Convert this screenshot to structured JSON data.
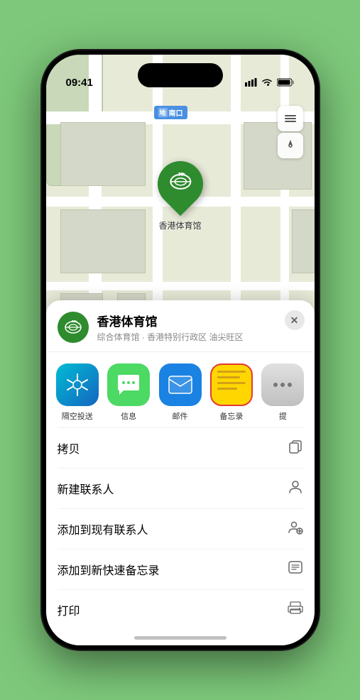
{
  "statusBar": {
    "time": "09:41",
    "signal": "●●●●",
    "wifi": "WiFi",
    "battery": "Battery"
  },
  "map": {
    "label": "南口",
    "mapIconLabel": "地图",
    "locationIcon": "⊕"
  },
  "pin": {
    "label": "香港体育馆",
    "icon": "🏟"
  },
  "venue": {
    "name": "香港体育馆",
    "description": "综合体育馆 · 香港特别行政区 油尖旺区",
    "icon": "🏟"
  },
  "shareActions": [
    {
      "id": "airdrop",
      "label": "隔空投送",
      "type": "airdrop"
    },
    {
      "id": "message",
      "label": "信息",
      "type": "message"
    },
    {
      "id": "mail",
      "label": "邮件",
      "type": "mail"
    },
    {
      "id": "notes",
      "label": "备忘录",
      "type": "notes"
    },
    {
      "id": "more",
      "label": "提",
      "type": "more"
    }
  ],
  "actions": [
    {
      "id": "copy",
      "label": "拷贝",
      "icon": "⿴"
    },
    {
      "id": "new-contact",
      "label": "新建联系人",
      "icon": "👤"
    },
    {
      "id": "add-existing",
      "label": "添加到现有联系人",
      "icon": "👤"
    },
    {
      "id": "add-notes",
      "label": "添加到新快速备忘录",
      "icon": "⊡"
    },
    {
      "id": "print",
      "label": "打印",
      "icon": "🖨"
    }
  ],
  "closeButton": "✕"
}
